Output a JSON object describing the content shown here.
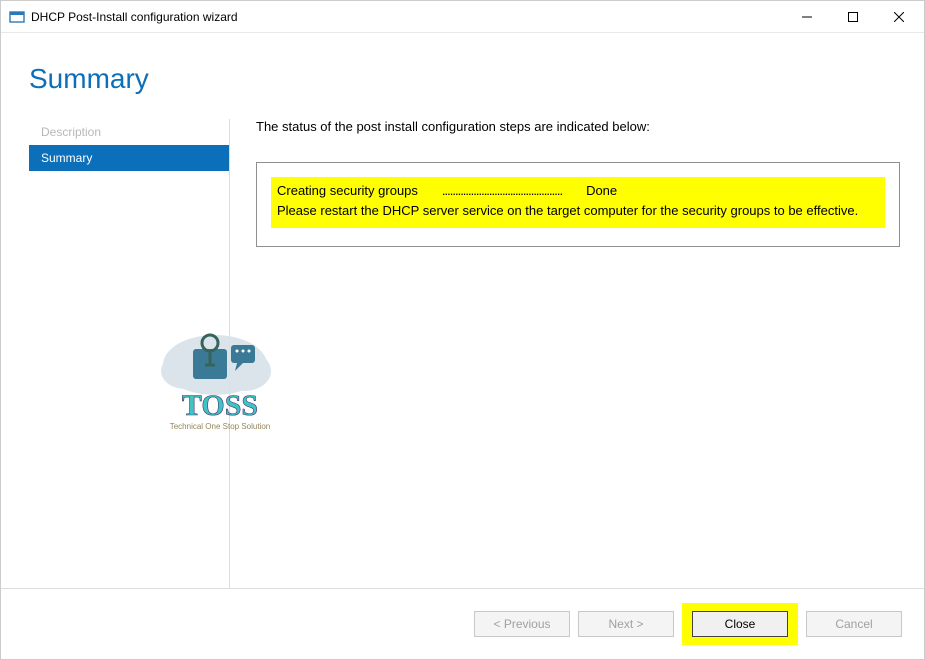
{
  "window": {
    "title": "DHCP Post-Install configuration wizard"
  },
  "heading": "Summary",
  "sidebar": {
    "items": [
      {
        "label": "Description",
        "state": "disabled"
      },
      {
        "label": "Summary",
        "state": "active"
      }
    ]
  },
  "main": {
    "intro": "The status of the post install configuration steps are indicated below:",
    "status": {
      "task": "Creating security groups",
      "dots": "..............................................",
      "result": "Done",
      "message": "Please restart the DHCP server service on the target computer for the security groups to be effective."
    }
  },
  "footer": {
    "previous": "< Previous",
    "next": "Next >",
    "close": "Close",
    "cancel": "Cancel"
  },
  "watermark": {
    "brand": "TOSS",
    "tagline": "Technical One Stop Solution"
  }
}
